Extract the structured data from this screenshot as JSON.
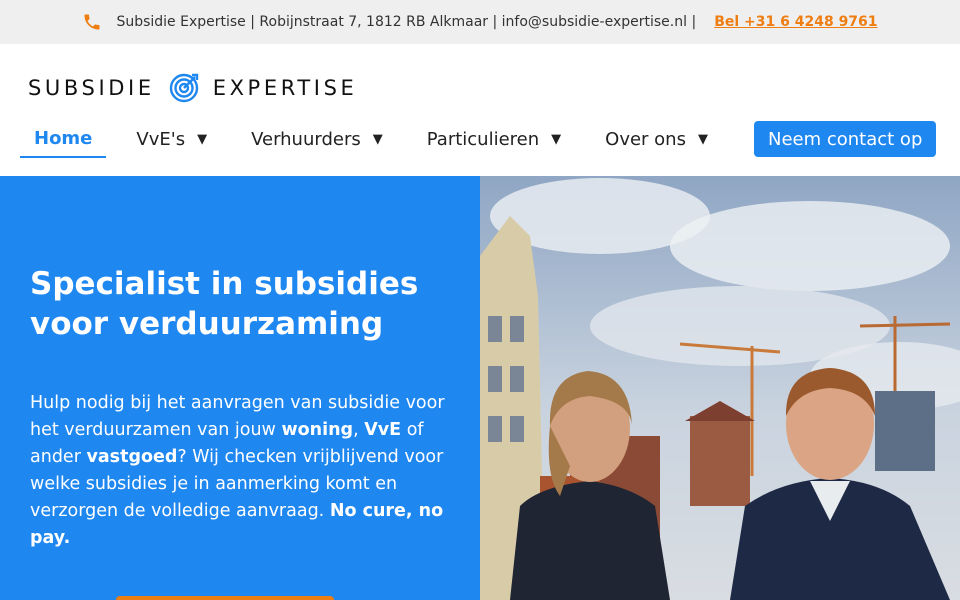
{
  "topbar": {
    "info": "Subsidie Expertise | Robijnstraat 7, 1812 RB Alkmaar | info@subsidie-expertise.nl |",
    "phone_link": "Bel +31 6 4248 9761",
    "icon": "phone-icon",
    "accent_color": "#ee7d12"
  },
  "logo": {
    "word1": "SUBSIDIE",
    "word2": "EXPERTISE",
    "icon": "target-icon"
  },
  "nav": {
    "items": [
      {
        "label": "Home",
        "active": true
      },
      {
        "label": "VvE's",
        "caret": "▼"
      },
      {
        "label": "Verhuurders",
        "caret": "▼"
      },
      {
        "label": "Particulieren",
        "caret": "▼"
      },
      {
        "label": "Over ons",
        "caret": "▼"
      }
    ],
    "cta": "Neem contact op"
  },
  "hero": {
    "title_line1": "Specialist in subsidies",
    "title_line2": "voor verduurzaming",
    "text": {
      "t1": "Hulp nodig bij het aanvragen van subsidie voor het verduurzamen van jouw ",
      "b1": "woning",
      "t2": ", ",
      "b2": "VvE",
      "t3": " of ander ",
      "b3": "vastgoed",
      "t4": "? Wij checken vrijblijvend voor welke subsidies je in aanmerking komt en verzorgen de volledige aanvraag. ",
      "b4": "No cure, no pay."
    },
    "bg_color": "#1f87f0",
    "button_color": "#ee7d12"
  }
}
